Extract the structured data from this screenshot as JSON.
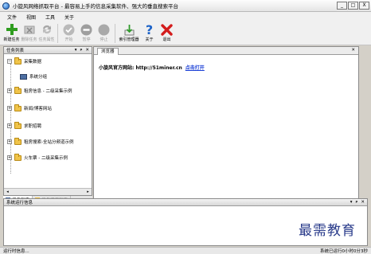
{
  "window": {
    "title": "小旋风网络抓取平台 - 最容易上手的信息采集软件、强大的垂直搜索平台",
    "controls": [
      "_",
      "□",
      "X"
    ]
  },
  "menu": [
    "文件",
    "视图",
    "工具",
    "关于"
  ],
  "toolbar": [
    {
      "label": "新建任务",
      "icon": "plus-icon",
      "enabled": true
    },
    {
      "label": "删除任务",
      "icon": "delete-x-icon",
      "enabled": false
    },
    {
      "label": "任务属性",
      "icon": "properties-arrows-icon",
      "enabled": false
    },
    {
      "label": "开始",
      "icon": "start-check-icon",
      "enabled": false
    },
    {
      "label": "暂停",
      "icon": "pause-icon",
      "enabled": false
    },
    {
      "label": "停止",
      "icon": "stop-icon",
      "enabled": false
    },
    {
      "label": "索引管理器",
      "icon": "download-arrow-icon",
      "enabled": true
    },
    {
      "label": "关于",
      "icon": "question-mark-icon",
      "enabled": true
    },
    {
      "label": "退出",
      "icon": "exit-x-icon",
      "enabled": true
    }
  ],
  "task_panel": {
    "title": "任务列表",
    "header_controls": [
      "▾",
      "ᴘ",
      "✕"
    ],
    "tree": {
      "root": "采集数据",
      "items": [
        {
          "label": "系统分组",
          "type": "computer"
        },
        {
          "label": "租房信息 - 二级采集示例",
          "type": "folder"
        },
        {
          "label": "新闻/博客网站",
          "type": "folder"
        },
        {
          "label": "求职招聘",
          "type": "folder"
        },
        {
          "label": "租房搜索-全站分频道示例",
          "type": "folder"
        },
        {
          "label": "火车票 - 二级采集示例",
          "type": "folder"
        }
      ]
    },
    "bottom_tabs": [
      "任务列表",
      "任务调度列表"
    ]
  },
  "browser": {
    "tab": "浏览器",
    "close": "✕",
    "site_text": "小旋风官方网站: http://51miner.cn",
    "open_link": "点击打开"
  },
  "log_panel": {
    "title": "系统运行信息",
    "header_controls": [
      "▾",
      "ᴘ",
      "✕"
    ],
    "watermark": "最需教育"
  },
  "status": {
    "left": "运行时信息...",
    "right": "系统已运行0小时0分3秒"
  },
  "colors": {
    "plus": "#2e9d1f",
    "exit": "#d31c1c",
    "question": "#1d63c8",
    "link": "#1a3fd6"
  }
}
